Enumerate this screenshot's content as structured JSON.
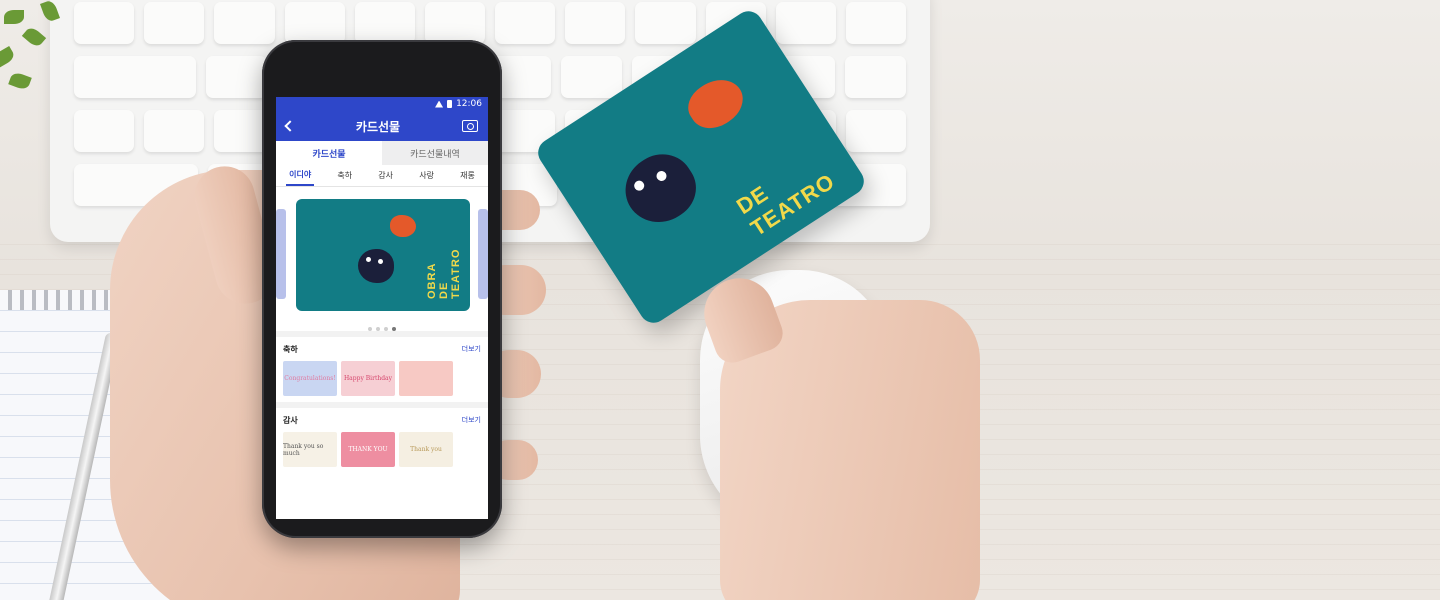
{
  "status_bar": {
    "time": "12:06"
  },
  "app_bar": {
    "title": "카드선물"
  },
  "segment_tabs": [
    {
      "label": "카드선물",
      "active": true
    },
    {
      "label": "카드선물내역",
      "active": false
    }
  ],
  "category_tabs": [
    {
      "label": "이디야",
      "active": true
    },
    {
      "label": "축하",
      "active": false
    },
    {
      "label": "감사",
      "active": false
    },
    {
      "label": "사랑",
      "active": false
    },
    {
      "label": "재롱",
      "active": false
    }
  ],
  "featured_card": {
    "text": "OBRA DE TEATRO"
  },
  "sections": [
    {
      "title": "축하",
      "more": "더보기",
      "thumbs": [
        {
          "text": "Congratulations!",
          "bg": "#c9d6f2"
        },
        {
          "text": "Happy Birthday",
          "bg": "#f6cfd4"
        },
        {
          "text": "",
          "bg": "#f7c9c4"
        }
      ]
    },
    {
      "title": "감사",
      "more": "더보기",
      "thumbs": [
        {
          "text": "Thank you so much",
          "bg": "#f6f1e6"
        },
        {
          "text": "THANK YOU",
          "bg": "#ee8ea1"
        },
        {
          "text": "Thank you",
          "bg": "#f5efe2"
        }
      ]
    }
  ],
  "held_card": {
    "text": "DE TEATRO"
  },
  "colors": {
    "brand_blue": "#2e47c9",
    "card_teal": "#127c85",
    "card_yellow": "#f1d94a"
  }
}
